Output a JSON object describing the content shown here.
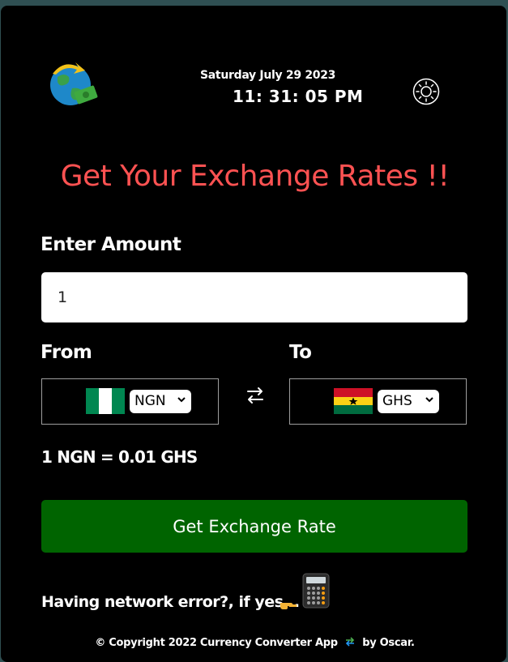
{
  "header": {
    "date": "Saturday July 29 2023",
    "time": "11: 31: 05 PM"
  },
  "heading": "Get Your Exchange Rates !!",
  "amount": {
    "label": "Enter Amount",
    "value": "1"
  },
  "from": {
    "label": "From",
    "currency": "NGN",
    "flag": "nigeria-flag"
  },
  "to": {
    "label": "To",
    "currency": "GHS",
    "flag": "ghana-flag"
  },
  "result": "1 NGN = 0.01 GHS",
  "button_label": "Get Exchange Rate",
  "network_prompt": "Having network error?, if yes...",
  "footer": {
    "prefix": "© Copyright 2022 Currency Converter App",
    "suffix": "by Oscar."
  },
  "icons": [
    "globe-money-logo-icon",
    "sun-icon",
    "swap-arrows-icon",
    "pointing-hand-icon",
    "calculator-icon",
    "exchange-icon"
  ],
  "colors": {
    "heading": "#ff5252",
    "button": "#006400",
    "background": "#000000",
    "outer": "#2f4f52"
  }
}
